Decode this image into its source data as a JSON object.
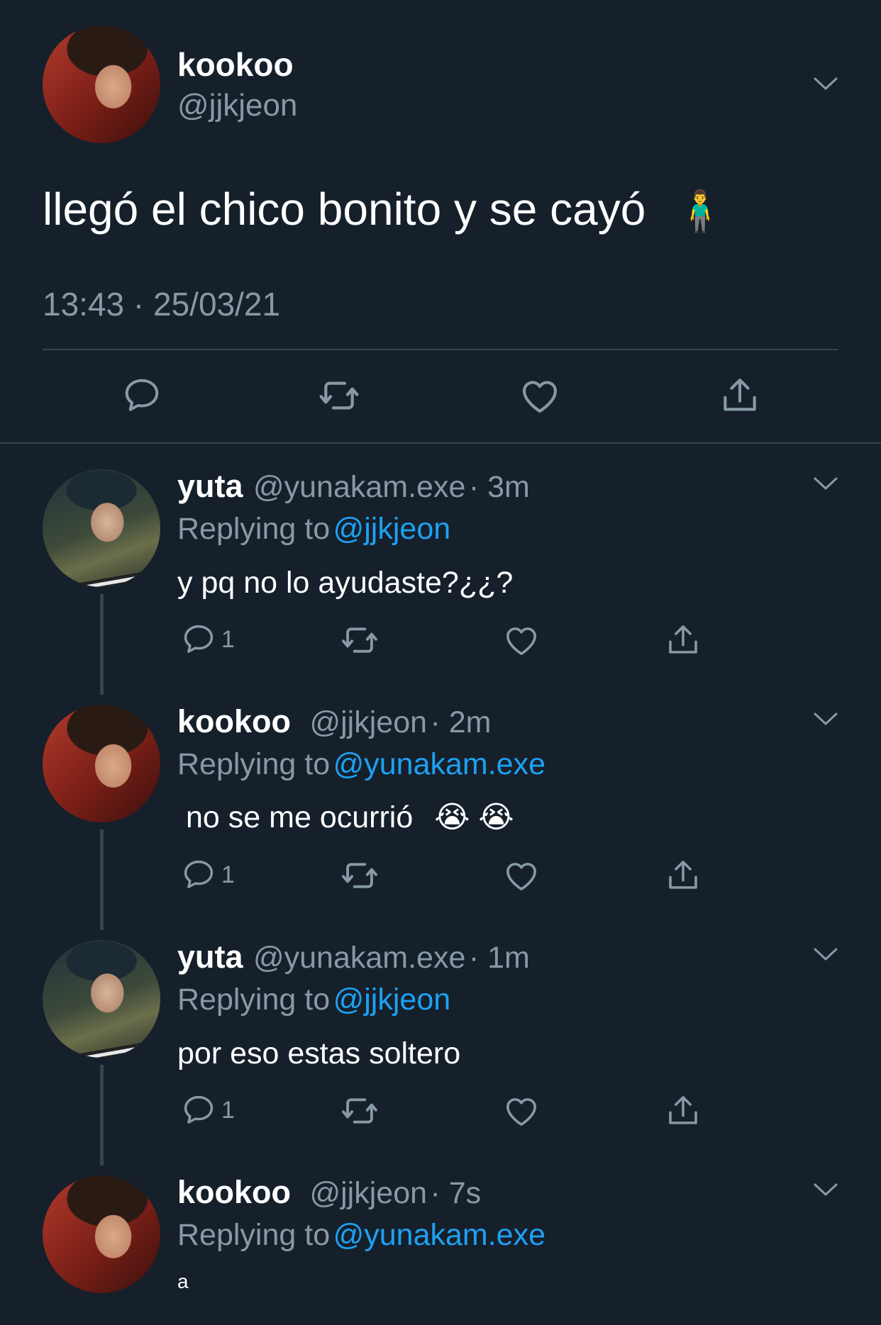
{
  "main_tweet": {
    "name": "kookoo",
    "handle": "@jjkjeon",
    "text": "llegó el chico bonito y se cayó",
    "emoji": "🧍‍♂️",
    "timestamp": "13:43 · 25/03/21"
  },
  "replies": [
    {
      "name": "yuta",
      "handle": "@yunakam.exe",
      "time": "· 3m",
      "replying_prefix": "Replying to",
      "replying_to": "@jjkjeon",
      "text": "y pq no lo ayudaste?¿¿?",
      "reply_count": "1"
    },
    {
      "name": "kookoo",
      "handle": "@jjkjeon",
      "time": "· 2m",
      "replying_prefix": "Replying to",
      "replying_to": "@yunakam.exe",
      "text": "no se me ocurrió",
      "emoji": "😭 😭",
      "reply_count": "1"
    },
    {
      "name": "yuta",
      "handle": "@yunakam.exe",
      "time": "· 1m",
      "replying_prefix": "Replying to",
      "replying_to": "@jjkjeon",
      "text": "por eso estas soltero",
      "reply_count": "1"
    },
    {
      "name": "kookoo",
      "handle": "@jjkjeon",
      "time": "· 7s",
      "replying_prefix": "Replying to",
      "replying_to": "@yunakam.exe",
      "text": "a"
    }
  ],
  "colors": {
    "background": "#15202b",
    "secondary_text": "#8899a6",
    "link": "#1da1f2",
    "divider": "#38444d"
  },
  "icons": [
    "chevron-down-icon",
    "reply-icon",
    "retweet-icon",
    "like-icon",
    "share-icon"
  ]
}
